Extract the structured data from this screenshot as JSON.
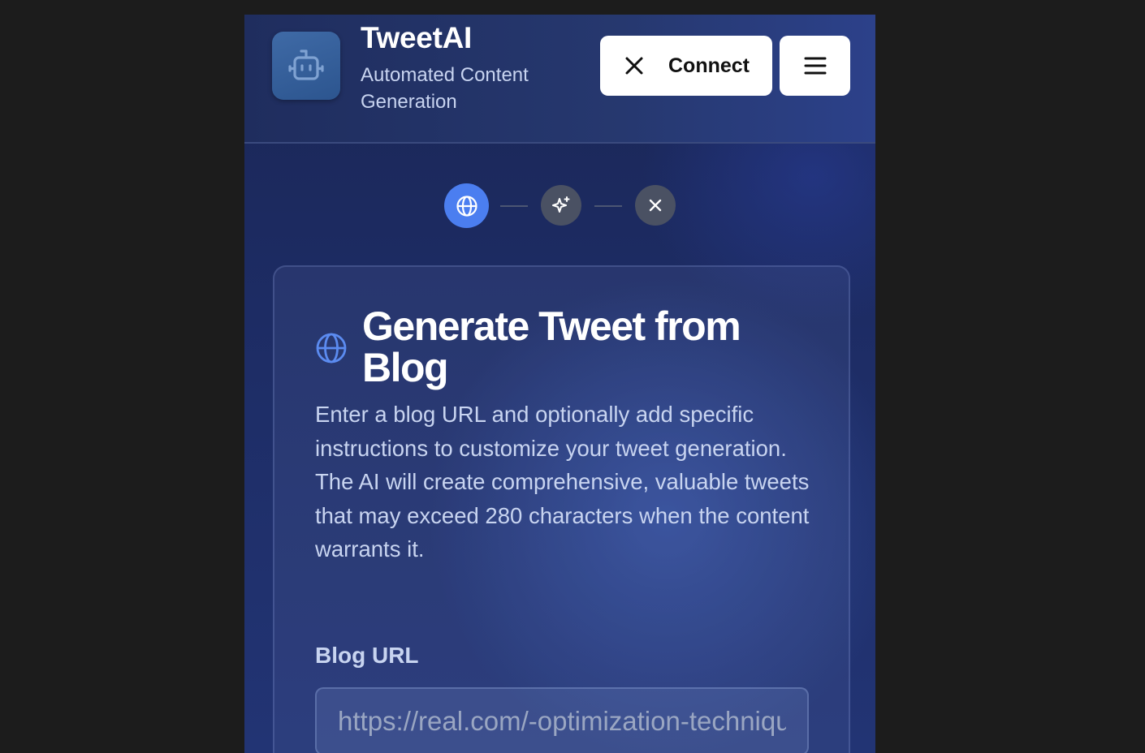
{
  "header": {
    "app_title": "TweetAI",
    "app_subtitle": "Automated Content Generation",
    "connect_label": "Connect"
  },
  "stepper": {
    "steps": [
      {
        "icon": "globe-icon",
        "state": "active"
      },
      {
        "icon": "sparkles-icon",
        "state": "pending"
      },
      {
        "icon": "close-icon",
        "state": "pending"
      }
    ]
  },
  "card": {
    "title": "Generate Tweet from Blog",
    "description": "Enter a blog URL and optionally add specific instructions to customize your tweet generation. The AI will create comprehensive, valuable tweets that may exceed 280 characters when the content warrants it.",
    "url_label": "Blog URL",
    "url_placeholder": "https://real.com/-optimization-techniques"
  },
  "colors": {
    "accent": "#4b7ef0",
    "step_inactive": "#4a5163",
    "background": "#1d2c64"
  }
}
